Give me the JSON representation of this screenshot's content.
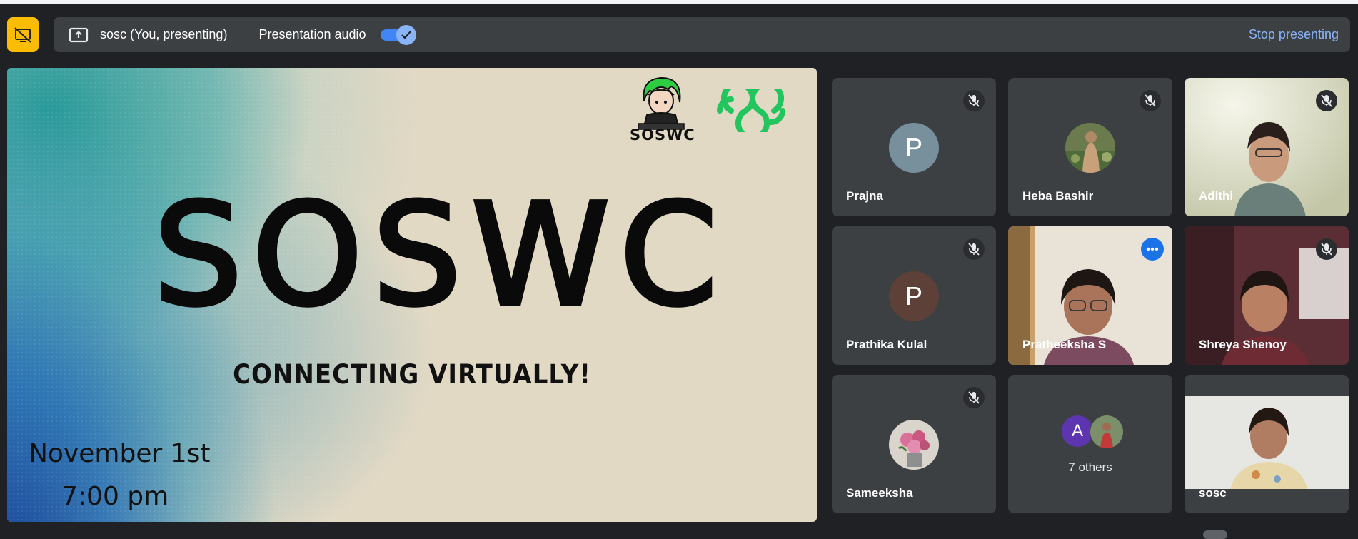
{
  "header": {
    "presenter_label": "sosc (You, presenting)",
    "audio_label": "Presentation audio",
    "audio_enabled": true,
    "stop_label": "Stop presenting",
    "accent_color": "#fbbc04",
    "link_color": "#8ab4f8",
    "icons": [
      "stop-sharing-icon",
      "present-screen-icon",
      "check-icon"
    ]
  },
  "slide": {
    "title": "SOSWC",
    "subtitle": "CONNECTING VIRTUALLY!",
    "date": "November 1st",
    "time": "7:00 pm",
    "mascot_text": "SOSWC"
  },
  "tiles": [
    {
      "name": "Prajna",
      "muted": true,
      "avatar": "P",
      "avatar_color": "#78909c"
    },
    {
      "name": "Heba Bashir",
      "muted": true,
      "avatar": "photo"
    },
    {
      "name": "Adithi",
      "muted": true,
      "avatar": "video"
    },
    {
      "name": "Prathika Kulal",
      "muted": true,
      "avatar": "P",
      "avatar_color": "#5d4037"
    },
    {
      "name": "Pratheeksha S",
      "muted": false,
      "avatar": "video",
      "active_speaker": true
    },
    {
      "name": "Shreya Shenoy",
      "muted": true,
      "avatar": "video"
    },
    {
      "name": "Sameeksha",
      "muted": true,
      "avatar": "photo"
    },
    {
      "name": "",
      "others_label": "7 others",
      "avatar": "A",
      "avatar_color": "#5e35b1"
    },
    {
      "name": "sosc",
      "muted": false,
      "avatar": "video"
    }
  ]
}
